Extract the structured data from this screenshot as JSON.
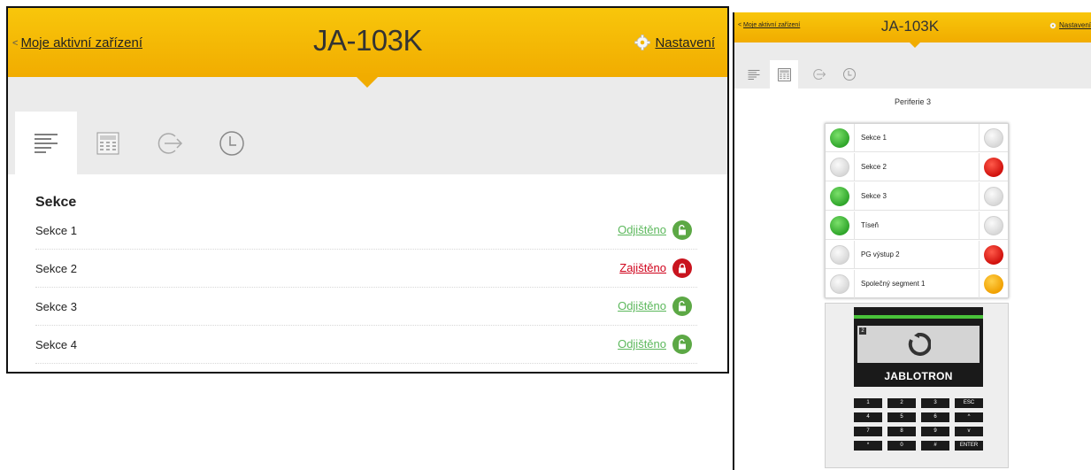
{
  "left": {
    "header": {
      "back_link": "Moje aktivní zařízení",
      "title": "JA-103K",
      "settings": "Nastavení"
    },
    "tabs": [
      {
        "icon": "list-icon",
        "active": true
      },
      {
        "icon": "keypad-icon",
        "active": false
      },
      {
        "icon": "exit-arrow-icon",
        "active": false
      },
      {
        "icon": "clock-icon",
        "active": false
      }
    ],
    "section_title": "Sekce",
    "sections": [
      {
        "name": "Sekce 1",
        "state": "Odjištěno",
        "status": "unlocked"
      },
      {
        "name": "Sekce 2",
        "state": "Zajištěno",
        "status": "locked"
      },
      {
        "name": "Sekce 3",
        "state": "Odjištěno",
        "status": "unlocked"
      },
      {
        "name": "Sekce 4",
        "state": "Odjištěno",
        "status": "unlocked"
      }
    ],
    "colors": {
      "header": "#f5b800",
      "unlocked": "#5cb85c",
      "locked": "#d0021b"
    }
  },
  "right": {
    "header": {
      "back_link": "Moje aktivní zařízení",
      "title": "JA-103K",
      "settings": "Nastavení"
    },
    "peripheral_title": "Periferie 3",
    "rows": [
      {
        "label": "Sekce 1",
        "left_led": "green",
        "right_led": "grey"
      },
      {
        "label": "Sekce 2",
        "left_led": "grey",
        "right_led": "red"
      },
      {
        "label": "Sekce 3",
        "left_led": "green",
        "right_led": "grey"
      },
      {
        "label": "Tíseň",
        "left_led": "green",
        "right_led": "grey"
      },
      {
        "label": "PG výstup 2",
        "left_led": "grey",
        "right_led": "red"
      },
      {
        "label": "Společný segment 1",
        "left_led": "grey",
        "right_led": "orange"
      }
    ],
    "keypad": {
      "brand": "JABLOTRON",
      "screen_badge": "2",
      "keys": [
        "1",
        "2",
        "3",
        "ESC",
        "4",
        "5",
        "6",
        "^",
        "7",
        "8",
        "9",
        "v",
        "*",
        "0",
        "#",
        "ENTER"
      ]
    }
  }
}
